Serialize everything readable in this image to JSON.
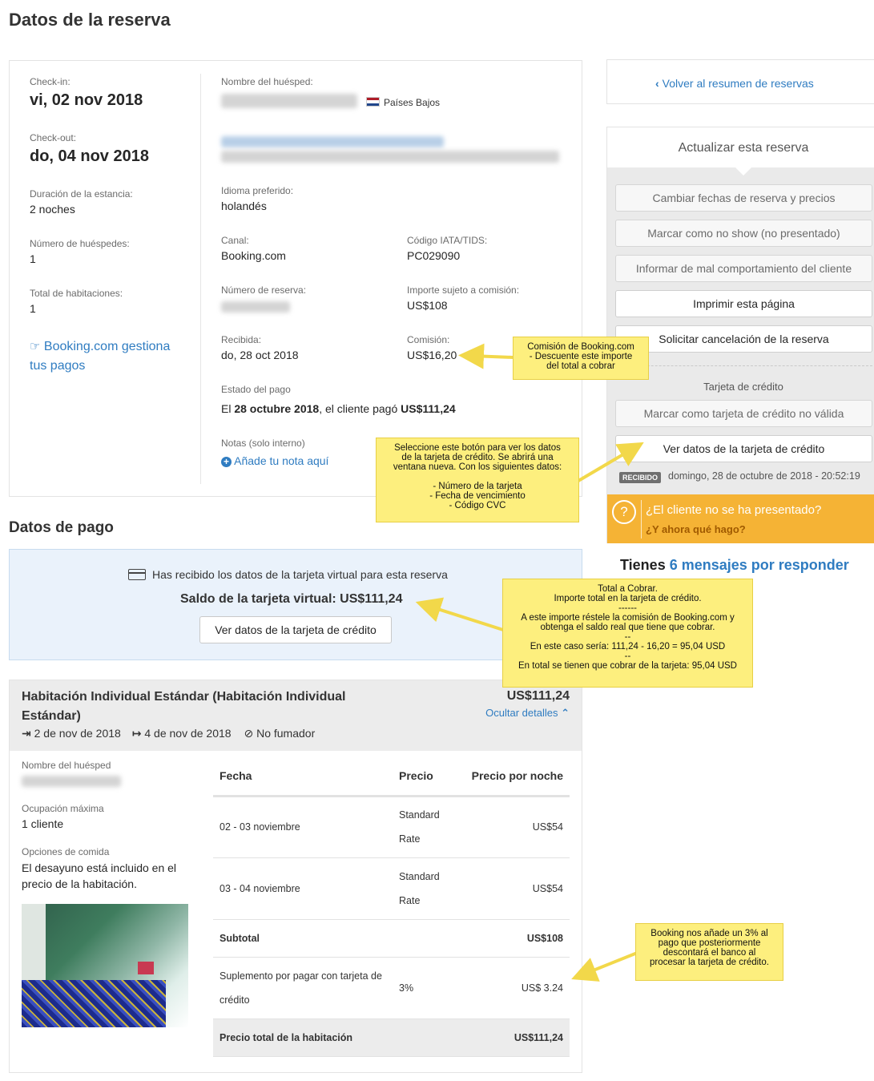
{
  "page": {
    "title": "Datos de la reserva"
  },
  "stay": {
    "checkin_label": "Check-in:",
    "checkin_value": "vi, 02 nov 2018",
    "checkout_label": "Check-out:",
    "checkout_value": "do, 04 nov 2018",
    "duration_label": "Duración de la estancia:",
    "duration_value": "2 noches",
    "guests_label": "Número de huéspedes:",
    "guests_value": "1",
    "rooms_label": "Total de habitaciones:",
    "rooms_value": "1",
    "payments_link": "Booking.com gestiona tus pagos"
  },
  "guest": {
    "name_label": "Nombre del huésped:",
    "country": "Países Bajos",
    "language_label": "Idioma preferido:",
    "language_value": "holandés",
    "channel_label": "Canal:",
    "channel_value": "Booking.com",
    "iata_label": "Código IATA/TIDS:",
    "iata_value": "PC029090",
    "booking_number_label": "Número de reserva:",
    "commissionable_label": "Importe sujeto a comisión:",
    "commissionable_value": "US$108",
    "received_label": "Recibida:",
    "received_value": "do, 28 oct 2018",
    "commission_label": "Comisión:",
    "commission_value": "US$16,20",
    "payment_status_label": "Estado del pago",
    "payment_status_prefix": "El ",
    "payment_status_date": "28 octubre 2018",
    "payment_status_middle": ", el cliente pagó ",
    "payment_status_amount": "US$111,24",
    "notes_label": "Notas (solo interno)",
    "notes_link": "Añade tu nota aquí"
  },
  "payment": {
    "title": "Datos de pago",
    "virtual_card_msg": "Has recibido los datos de la tarjeta virtual para esta reserva",
    "virtual_balance": "Saldo de la tarjeta virtual: US$111,24",
    "view_card_button": "Ver datos de la tarjeta de crédito"
  },
  "room": {
    "title": "Habitación Individual Estándar (Habitación Individual Estándar)",
    "price": "US$111,24",
    "hide_details": "Ocultar detalles",
    "checkin": "2 de nov de 2018",
    "checkout": "4 de nov de 2018",
    "smoking": "No fumador",
    "guest_name_label": "Nombre del huésped",
    "max_occupancy_label": "Ocupación máxima",
    "max_occupancy_value": "1 cliente",
    "meal_label": "Opciones de comida",
    "meal_value": "El desayuno está incluido en el precio de la habitación.",
    "table_headers": [
      "Fecha",
      "Precio",
      "Precio por noche"
    ],
    "rows": [
      {
        "date": "02 - 03 noviembre",
        "rate": "Standard Rate",
        "price": "US$54"
      },
      {
        "date": "03 - 04 noviembre",
        "rate": "Standard Rate",
        "price": "US$54"
      }
    ],
    "subtotal_label": "Subtotal",
    "subtotal_value": "US$108",
    "surcharge_label": "Suplemento por pagar con tarjeta de crédito",
    "surcharge_pct": "3%",
    "surcharge_value": "US$ 3.24",
    "total_label": "Precio total de la habitación",
    "total_value": "US$111,24"
  },
  "sidebar": {
    "back_link": "Volver al resumen de reservas",
    "update_title": "Actualizar esta reserva",
    "buttons": [
      "Cambiar fechas de reserva y precios",
      "Marcar como no show (no presentado)",
      "Informar de mal comportamiento del cliente",
      "Imprimir esta página",
      "Solicitar cancelación de la reserva"
    ],
    "credit_card_title": "Tarjeta de crédito",
    "invalid_card_button": "Marcar como tarjeta de crédito no válida",
    "view_card_button": "Ver datos de la tarjeta de crédito",
    "received_badge": "RECIBIDO",
    "received_date": "domingo, 28 de octubre de 2018 - 20:52:19",
    "noshow_q": "¿El cliente no se ha presentado?",
    "noshow_a": "¿Y ahora qué hago?",
    "messages_prefix": "Tienes ",
    "messages_link": "6 mensajes por responder"
  },
  "annotations": {
    "commission": "Comisión de Booking.com\n- Descuente este importe\ndel total a cobrar",
    "view_card": "Seleccione este botón para ver los datos\nde la tarjeta de crédito. Se abrirá una\nventana nueva. Con los siguientes datos:\n\n- Número de la tarjeta\n- Fecha de vencimiento\n- Código CVC",
    "total": "Total a Cobrar.\nImporte total en la tarjeta de crédito.\n------\nA este importe réstele la comisión de Booking.com y\nobtenga el saldo real que tiene que cobrar.\n--\nEn este caso sería: 111,24 - 16,20 = 95,04 USD\n--\nEn total se tienen que cobrar de la tarjeta: 95,04 USD",
    "surcharge": "Booking nos añade un 3% al\npago que posteriormente\ndescontará el banco al\nprocesar la tarjeta de crédito."
  },
  "colors": {
    "accent": "#2f7cc1",
    "noshow_bg": "#f5b335",
    "note_bg": "#fdef7e",
    "virtual_card_bg": "#eaf2fb"
  }
}
